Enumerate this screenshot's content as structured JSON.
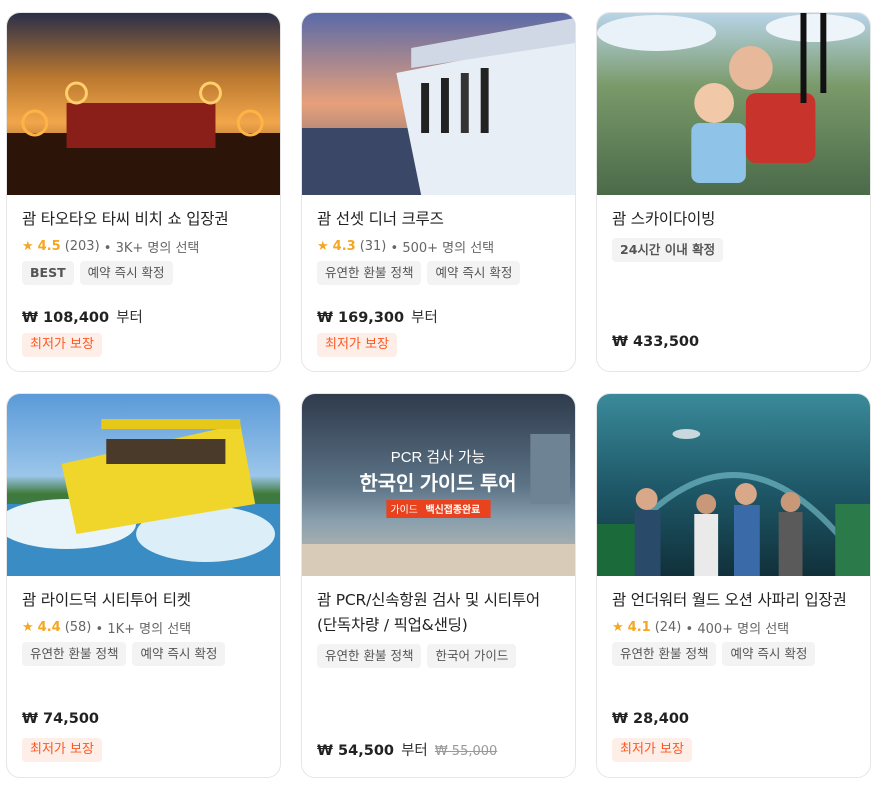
{
  "cards": [
    {
      "title": "괌 타오타오 타씨 비치 쇼 입장권",
      "rating_score": "4.5",
      "rating_count": "(203)",
      "rating_booked": "• 3K+ 명의 선택",
      "tags": [
        "BEST",
        "예약 즉시 확정"
      ],
      "price": "₩ 108,400",
      "price_suffix": "부터",
      "badge": "최저가 보장"
    },
    {
      "title": "괌 선셋 디너 크루즈",
      "rating_score": "4.3",
      "rating_count": "(31)",
      "rating_booked": "• 500+ 명의 선택",
      "tags": [
        "유연한 환불 정책",
        "예약 즉시 확정"
      ],
      "price": "₩ 169,300",
      "price_suffix": "부터",
      "badge": "최저가 보장"
    },
    {
      "title": "괌 스카이다이빙",
      "tags": [
        "24시간 이내 확정"
      ],
      "price": "₩ 433,500"
    },
    {
      "title": "괌 라이드덕 시티투어 티켓",
      "rating_score": "4.4",
      "rating_count": "(58)",
      "rating_booked": "• 1K+ 명의 선택",
      "tags": [
        "유연한 환불 정책",
        "예약 즉시 확정"
      ],
      "price": "₩ 74,500",
      "badge": "최저가 보장"
    },
    {
      "title": "괌 PCR/신속항원 검사 및 시티투어 (단독차량 / 픽업&샌딩)",
      "tags": [
        "유연한 환불 정책",
        "한국어 가이드"
      ],
      "price": "₩ 54,500",
      "price_suffix": "부터",
      "old_price": "₩ 55,000",
      "image_text": {
        "line1": "PCR 검사 가능",
        "line2": "한국인 가이드 투어",
        "line3_a": "가이드",
        "line3_b": "백신접종완료"
      }
    },
    {
      "title": "괌 언더워터 월드 오션 사파리 입장권",
      "rating_score": "4.1",
      "rating_count": "(24)",
      "rating_booked": "• 400+ 명의 선택",
      "tags": [
        "유연한 환불 정책",
        "예약 즉시 확정"
      ],
      "price": "₩ 28,400",
      "badge": "최저가 보장"
    }
  ],
  "icons": {
    "star": "star-icon"
  },
  "colors": {
    "accent": "#f5a623",
    "badge_text": "#ff5722",
    "badge_bg": "#fdeee8",
    "tag_bg": "#f3f3f3"
  }
}
